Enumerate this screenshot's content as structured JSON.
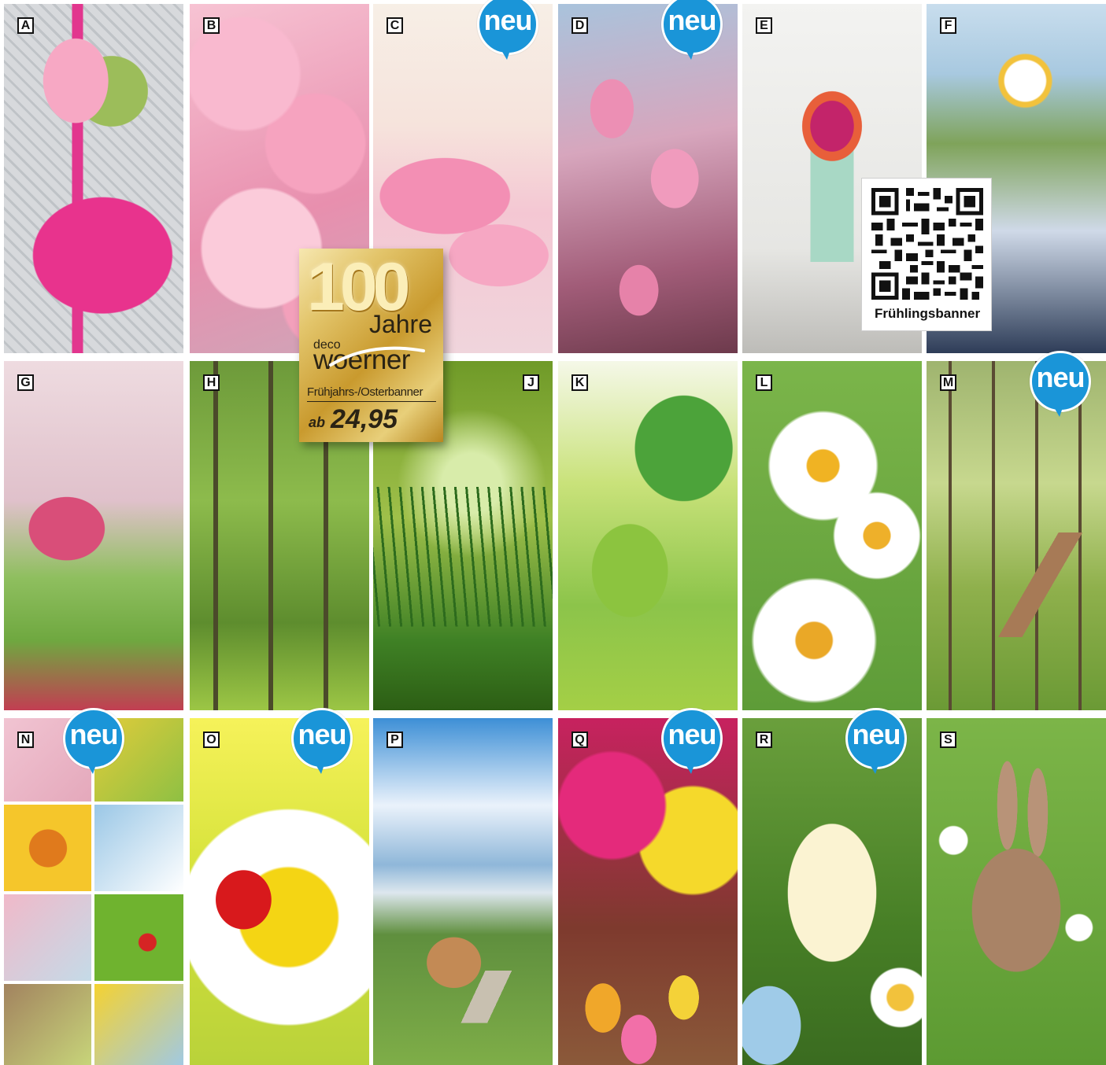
{
  "tiles": [
    {
      "letter": "A"
    },
    {
      "letter": "B"
    },
    {
      "letter": "C"
    },
    {
      "letter": "D"
    },
    {
      "letter": "E"
    },
    {
      "letter": "F"
    },
    {
      "letter": "G"
    },
    {
      "letter": "H"
    },
    {
      "letter": "J"
    },
    {
      "letter": "K"
    },
    {
      "letter": "L"
    },
    {
      "letter": "M"
    },
    {
      "letter": "N"
    },
    {
      "letter": "O"
    },
    {
      "letter": "P"
    },
    {
      "letter": "Q"
    },
    {
      "letter": "R"
    },
    {
      "letter": "S"
    }
  ],
  "neu_label": "neu",
  "badge": {
    "number": "100",
    "years": "Jahre",
    "brand_small": "deco",
    "brand": "woerner",
    "subtitle": "Frühjahrs-/Osterbanner",
    "price_prefix": "ab",
    "price": "24,95"
  },
  "qr": {
    "caption": "Frühlingsbanner"
  },
  "colors": {
    "neu_blue": "#1a95d8",
    "badge_gold": "#d9b24e"
  }
}
